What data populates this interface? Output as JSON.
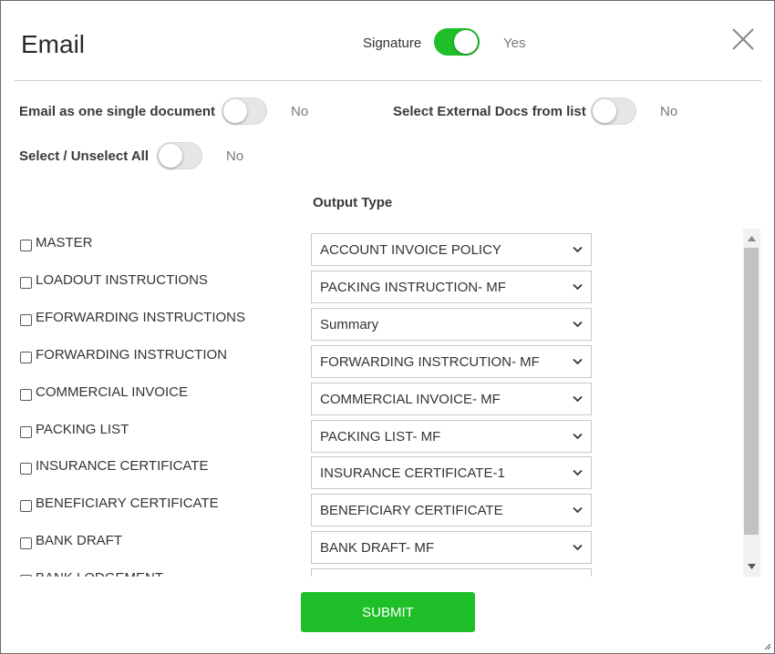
{
  "dialog": {
    "title": "Email",
    "signature": {
      "label": "Signature",
      "enabled": true,
      "state_text": "Yes"
    },
    "close_icon": "close-icon"
  },
  "options": {
    "single_document": {
      "label": "Email as one single document",
      "enabled": false,
      "state_text": "No"
    },
    "external_docs": {
      "label": "Select External Docs from list",
      "enabled": false,
      "state_text": "No"
    },
    "select_all": {
      "label": "Select / Unselect All",
      "enabled": false,
      "state_text": "No"
    }
  },
  "output_type_header": "Output Type",
  "documents": [
    {
      "name": "MASTER",
      "checked": false,
      "output": "ACCOUNT INVOICE POLICY"
    },
    {
      "name": "LOADOUT INSTRUCTIONS",
      "checked": false,
      "output": "PACKING INSTRUCTION- MF"
    },
    {
      "name": "EFORWARDING INSTRUCTIONS",
      "checked": false,
      "output": "Summary"
    },
    {
      "name": "FORWARDING INSTRUCTION",
      "checked": false,
      "output": "FORWARDING INSTRCUTION- MF"
    },
    {
      "name": "COMMERCIAL INVOICE",
      "checked": false,
      "output": "COMMERCIAL INVOICE- MF"
    },
    {
      "name": "PACKING LIST",
      "checked": false,
      "output": "PACKING LIST- MF"
    },
    {
      "name": "INSURANCE CERTIFICATE",
      "checked": false,
      "output": "INSURANCE CERTIFICATE-1"
    },
    {
      "name": "BENEFICIARY CERTIFICATE",
      "checked": false,
      "output": "BENEFICIARY CERTIFICATE"
    },
    {
      "name": "BANK DRAFT",
      "checked": false,
      "output": "BANK DRAFT- MF"
    },
    {
      "name": "BANK LODGEMENT",
      "checked": false,
      "output": ""
    }
  ],
  "submit_label": "SUBMIT",
  "colors": {
    "accent": "#1fbf2a",
    "toggle_off": "#e6e6e6",
    "text": "#333333"
  }
}
